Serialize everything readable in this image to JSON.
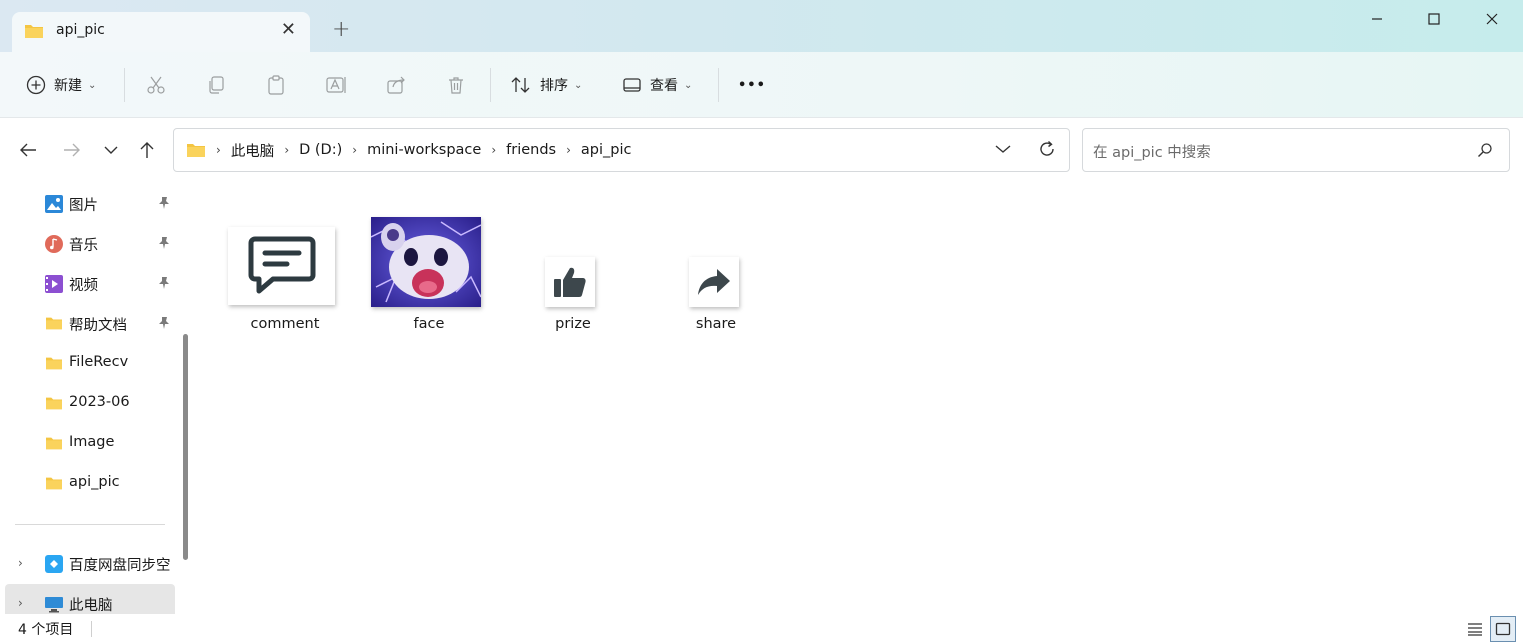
{
  "window": {
    "tab_title": "api_pic",
    "new_tab_glyph": "+",
    "close_tab_glyph": "✕"
  },
  "toolbar": {
    "new_label": "新建",
    "sort_label": "排序",
    "view_label": "查看",
    "more_glyph": "•••",
    "caret": "⌄"
  },
  "address": {
    "crumbs": [
      "此电脑",
      "D (D:)",
      "mini-workspace",
      "friends",
      "api_pic"
    ],
    "separator": "›",
    "search_placeholder": "在 api_pic 中搜索"
  },
  "sidebar": {
    "items": [
      {
        "label": "图片",
        "icon": "pictures-icon",
        "pinned": true
      },
      {
        "label": "音乐",
        "icon": "music-icon",
        "pinned": true
      },
      {
        "label": "视频",
        "icon": "video-icon",
        "pinned": true
      },
      {
        "label": "帮助文档",
        "icon": "folder-icon",
        "pinned": true
      },
      {
        "label": "FileRecv",
        "icon": "folder-icon",
        "pinned": false
      },
      {
        "label": "2023-06",
        "icon": "folder-icon",
        "pinned": false
      },
      {
        "label": "Image",
        "icon": "folder-icon",
        "pinned": false
      },
      {
        "label": "api_pic",
        "icon": "folder-icon",
        "pinned": false
      }
    ],
    "drives": [
      {
        "label": "百度网盘同步空",
        "icon": "baidu-netdisk-icon"
      },
      {
        "label": "此电脑",
        "icon": "this-pc-icon"
      }
    ],
    "expander_glyph": "›"
  },
  "files": [
    {
      "name": "comment",
      "icon": "comment-icon"
    },
    {
      "name": "face",
      "icon": "face-image-icon"
    },
    {
      "name": "prize",
      "icon": "thumbs-up-icon"
    },
    {
      "name": "share",
      "icon": "share-arrow-icon"
    }
  ],
  "status": {
    "item_count": "4 个项目"
  },
  "colors": {
    "folder": "#f4c542",
    "titlebar_start": "#dbe8f2",
    "titlebar_end": "#c6ecec",
    "icon_dark": "#2d3a40"
  }
}
